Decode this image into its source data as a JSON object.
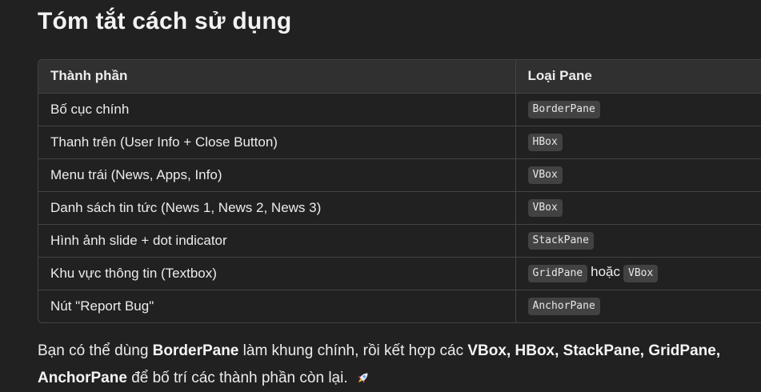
{
  "heading": "Tóm tắt cách sử dụng",
  "table": {
    "headers": [
      "Thành phần",
      "Loại Pane"
    ],
    "rows": [
      {
        "component": "Bố cục chính",
        "pane": "BorderPane",
        "alt_sep": "",
        "alt": ""
      },
      {
        "component": "Thanh trên (User Info + Close Button)",
        "pane": "HBox",
        "alt_sep": "",
        "alt": ""
      },
      {
        "component": "Menu trái (News, Apps, Info)",
        "pane": "VBox",
        "alt_sep": "",
        "alt": ""
      },
      {
        "component": "Danh sách tin tức (News 1, News 2, News 3)",
        "pane": "VBox",
        "alt_sep": "",
        "alt": ""
      },
      {
        "component": "Hình ảnh slide + dot indicator",
        "pane": "StackPane",
        "alt_sep": "",
        "alt": ""
      },
      {
        "component": "Khu vực thông tin (Textbox)",
        "pane": "GridPane",
        "alt_sep": "hoặc",
        "alt": "VBox"
      },
      {
        "component": "Nút \"Report Bug\"",
        "pane": "AnchorPane",
        "alt_sep": "",
        "alt": ""
      }
    ]
  },
  "paragraph": {
    "p1": "Bạn có thể dùng ",
    "b1": "BorderPane",
    "p2": " làm khung chính, rồi kết hợp các ",
    "b2": "VBox, HBox, StackPane, GridPane, AnchorPane",
    "p3": " để bố trí các thành phần còn lại.",
    "emoji": "rocket-icon"
  },
  "colors": {
    "background": "#212121",
    "header_bg": "#303030",
    "border": "#444444",
    "code_bg": "#424242",
    "text": "#ececec"
  }
}
